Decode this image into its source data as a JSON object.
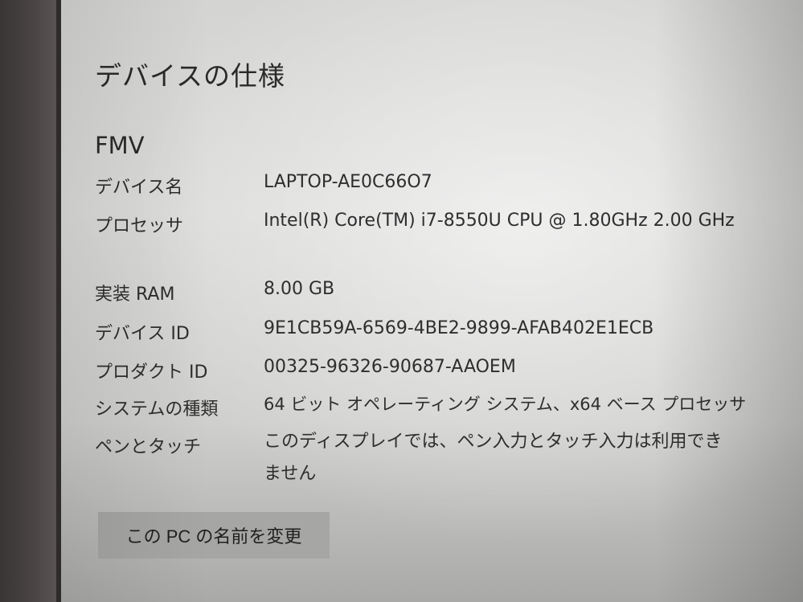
{
  "page": {
    "title": "デバイスの仕様",
    "brand": "FMV"
  },
  "specs": [
    {
      "label": "デバイス名",
      "value": "LAPTOP-AE0C66O7"
    },
    {
      "label": "プロセッサ",
      "value": "Intel(R) Core(TM) i7-8550U CPU @ 1.80GHz   2.00 GHz"
    },
    {
      "label": "実装 RAM",
      "value": "8.00 GB"
    },
    {
      "label": "デバイス ID",
      "value": "9E1CB59A-6569-4BE2-9899-AFAB402E1ECB"
    },
    {
      "label": "プロダクト ID",
      "value": "00325-96326-90687-AAOEM"
    },
    {
      "label": "システムの種類",
      "value": "64 ビット オペレーティング システム、x64 ベース プロセッサ"
    },
    {
      "label": "ペンとタッチ",
      "value": "このディスプレイでは、ペン入力とタッチ入力は利用できません"
    }
  ],
  "actions": {
    "rename_label": "この PC の名前を変更"
  }
}
